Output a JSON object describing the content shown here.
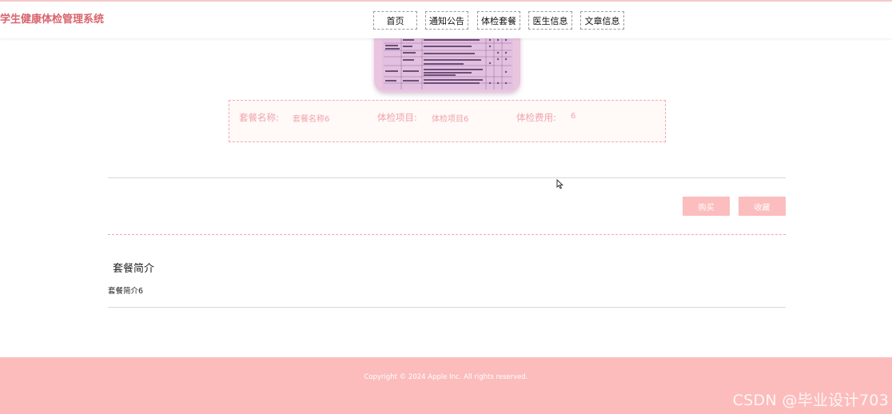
{
  "header": {
    "site_title": "学生健康体检管理系统",
    "nav": [
      "首页",
      "通知公告",
      "体检套餐",
      "医生信息",
      "文章信息"
    ]
  },
  "package": {
    "name_label": "套餐名称:",
    "name_value": "套餐名称6",
    "items_label": "体检项目:",
    "items_value": "体检项目6",
    "fee_label": "体检费用:",
    "fee_value": "6"
  },
  "actions": {
    "buy_label": "购买",
    "favorite_label": "收藏"
  },
  "intro": {
    "title": "套餐简介",
    "body": "套餐简介6"
  },
  "footer": {
    "copyright": "Copyright © 2024 Apple Inc. All rights reserved.",
    "watermark": "CSDN @毕业设计703"
  },
  "colors": {
    "brand": "#d9646c",
    "accent": "#fbbdbe",
    "footer_bg": "#fcbcbc"
  }
}
